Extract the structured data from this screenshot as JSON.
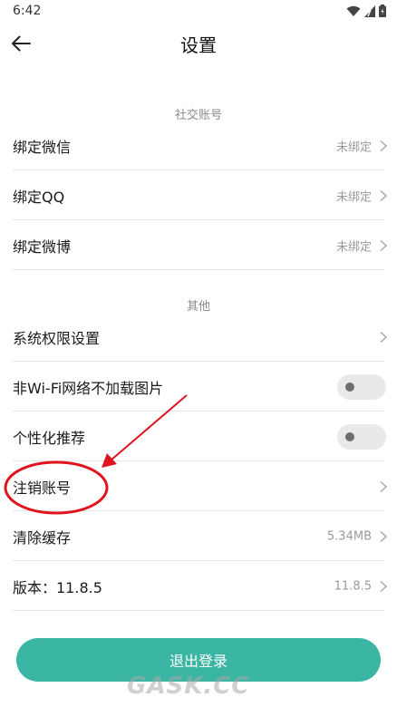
{
  "status_bar": {
    "time": "6:42"
  },
  "header": {
    "title": "设置"
  },
  "sections": {
    "social": {
      "title": "社交账号",
      "items": [
        {
          "label": "绑定微信",
          "value": "未绑定"
        },
        {
          "label": "绑定QQ",
          "value": "未绑定"
        },
        {
          "label": "绑定微博",
          "value": "未绑定"
        }
      ]
    },
    "other": {
      "title": "其他",
      "items": [
        {
          "label": "系统权限设置"
        },
        {
          "label": "非Wi-Fi网络不加载图片",
          "toggle": false
        },
        {
          "label": "个性化推荐",
          "toggle": false
        },
        {
          "label": "注销账号"
        },
        {
          "label": "清除缓存",
          "value": "5.34MB"
        },
        {
          "label": "版本：11.8.5",
          "value": "11.8.5"
        }
      ]
    }
  },
  "logout_button": {
    "label": "退出登录"
  },
  "watermark": {
    "text": "GASK.CC"
  },
  "colors": {
    "accent": "#3bb5a4",
    "annotation": "#e0141e",
    "toggle_off": "#e9e9e9"
  }
}
